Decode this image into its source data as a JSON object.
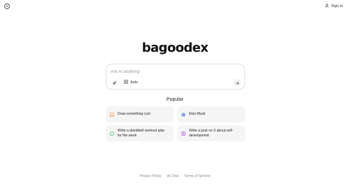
{
  "header": {
    "sign_in_label": "Sign In"
  },
  "brand": {
    "logo_text": "bagoodex"
  },
  "composer": {
    "placeholder": "Ask AI anything",
    "model_label": "Auto"
  },
  "popular": {
    "title": "Popular",
    "items": [
      {
        "label": "Draw something cool",
        "icon": "image-icon",
        "color": "#e8863a"
      },
      {
        "label": "Elon Musk",
        "icon": "globe-icon",
        "color": "#3b7be8"
      },
      {
        "label": "Write a dumbbell workout plan for the week",
        "icon": "whatsapp-icon",
        "color": "#2bb55a"
      },
      {
        "label": "Write a post on X about self-development",
        "icon": "instagram-icon",
        "color": "#b04be0"
      }
    ]
  },
  "footer": {
    "links": [
      "Privacy Policy",
      "AI Chat",
      "Terms of Service"
    ]
  }
}
